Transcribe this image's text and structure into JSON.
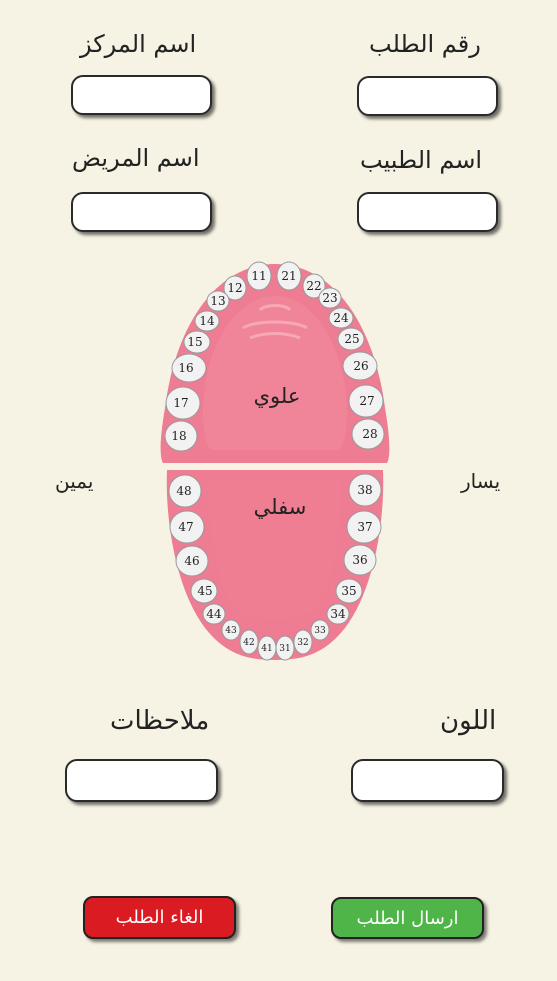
{
  "form": {
    "order_number_label": "رقم الطلب",
    "center_name_label": "اسم المركز",
    "doctor_name_label": "اسم الطبيب",
    "patient_name_label": "اسم المريض",
    "color_label": "اللون",
    "notes_label": "ملاحظات"
  },
  "chart": {
    "upper_label": "علوي",
    "lower_label": "سفلي",
    "right_label": "يمين",
    "left_label": "يسار",
    "upper_teeth": [
      "11",
      "12",
      "13",
      "14",
      "15",
      "16",
      "17",
      "18",
      "21",
      "22",
      "23",
      "24",
      "25",
      "26",
      "27",
      "28"
    ],
    "lower_teeth": [
      "31",
      "32",
      "33",
      "34",
      "35",
      "36",
      "37",
      "38",
      "41",
      "42",
      "43",
      "44",
      "45",
      "46",
      "47",
      "48"
    ]
  },
  "buttons": {
    "send_label": "ارسال الطلب",
    "cancel_label": "الغاء الطلب"
  },
  "colors": {
    "background": "#f7f3e4",
    "gum": "#ee7c92",
    "tongue": "#ef7e93",
    "send": "#4fb548",
    "cancel": "#da1c22"
  }
}
